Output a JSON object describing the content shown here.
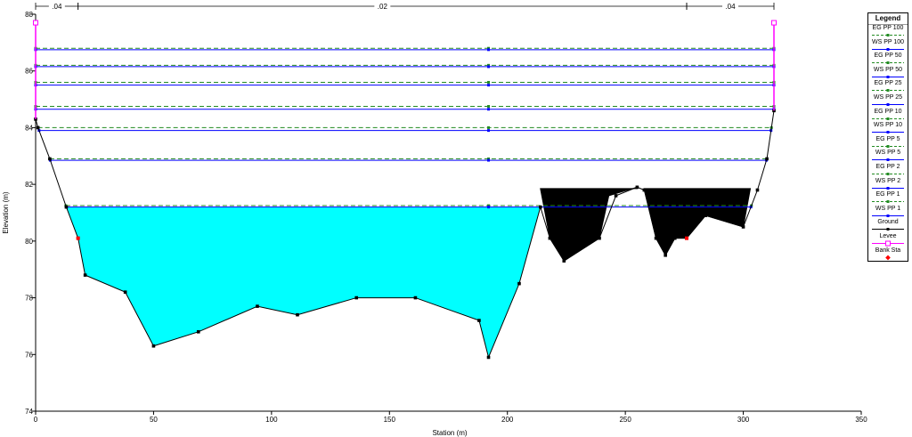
{
  "chart_data": {
    "type": "area",
    "xlabel": "Station (m)",
    "ylabel": "Elevation (m)",
    "xlim": [
      0,
      350
    ],
    "ylim": [
      74,
      88
    ],
    "x_ticks": [
      "0",
      "50",
      "100",
      "150",
      "200",
      "250",
      "300",
      "350"
    ],
    "y_ticks": [
      "74",
      "76",
      "78",
      "80",
      "82",
      "84",
      "86",
      "88"
    ],
    "manning_n": [
      {
        "label": ".04",
        "from": 0,
        "to": 18
      },
      {
        "label": ".02",
        "from": 18,
        "to": 276
      },
      {
        "label": ".04",
        "from": 276,
        "to": 313
      }
    ],
    "ground": {
      "name": "Ground",
      "color": "#000000",
      "x": [
        0,
        1,
        6,
        13,
        18,
        21,
        38,
        50,
        69,
        94,
        111,
        136,
        161,
        188,
        192,
        205,
        214,
        218,
        224,
        239,
        246,
        255,
        258,
        263,
        267,
        271,
        276,
        284,
        300,
        306,
        310,
        313
      ],
      "y": [
        84.3,
        84.0,
        82.9,
        81.2,
        80.1,
        78.8,
        78.2,
        76.3,
        76.8,
        77.7,
        77.4,
        78.0,
        78.0,
        77.2,
        75.9,
        78.5,
        81.2,
        80.1,
        79.3,
        80.1,
        81.6,
        81.9,
        81.8,
        80.1,
        79.5,
        80.1,
        80.1,
        80.9,
        80.5,
        81.8,
        82.9,
        84.6
      ]
    },
    "ineffective_blocks": [
      {
        "x": [
          214,
          230,
          243,
          255,
          255,
          243,
          239,
          224,
          218
        ],
        "y": [
          81.85,
          81.85,
          81.85,
          81.85,
          81.9,
          81.6,
          80.1,
          79.3,
          80.1
        ]
      },
      {
        "x": [
          258,
          275,
          295,
          303,
          300,
          284,
          276,
          271,
          267,
          263
        ],
        "y": [
          81.85,
          81.85,
          81.85,
          81.85,
          80.5,
          80.9,
          80.1,
          80.1,
          79.5,
          80.1
        ]
      }
    ],
    "levee": {
      "name": "Levee",
      "color": "#ff00ff",
      "x": [
        0,
        313
      ],
      "y": [
        87.7,
        87.7
      ]
    },
    "bank_sta": {
      "name": "Bank Sta",
      "color": "#ff0000",
      "points": [
        {
          "x": 18,
          "y": 80.1
        },
        {
          "x": 276,
          "y": 80.1
        }
      ]
    },
    "water_fill": {
      "color": "#00ffff",
      "elevation": 81.2
    },
    "profiles": [
      {
        "name": "EG PP 100",
        "kind": "EG",
        "y": 86.8,
        "color": "#228b22"
      },
      {
        "name": "WS PP 100",
        "kind": "WS",
        "y": 86.75,
        "color": "#0000ff"
      },
      {
        "name": "EG PP 50",
        "kind": "EG",
        "y": 86.2,
        "color": "#228b22"
      },
      {
        "name": "WS PP 50",
        "kind": "WS",
        "y": 86.15,
        "color": "#0000ff"
      },
      {
        "name": "EG PP 25",
        "kind": "EG",
        "y": 85.6,
        "color": "#228b22"
      },
      {
        "name": "WS PP 25",
        "kind": "WS",
        "y": 85.5,
        "color": "#0000ff"
      },
      {
        "name": "EG PP 10",
        "kind": "EG",
        "y": 84.75,
        "color": "#228b22"
      },
      {
        "name": "WS PP 10",
        "kind": "WS",
        "y": 84.65,
        "color": "#0000ff"
      },
      {
        "name": "EG PP 5",
        "kind": "EG",
        "y": 84.0,
        "color": "#228b22"
      },
      {
        "name": "WS PP 5",
        "kind": "WS",
        "y": 83.9,
        "color": "#0000ff"
      },
      {
        "name": "EG PP 2",
        "kind": "EG",
        "y": 82.9,
        "color": "#228b22"
      },
      {
        "name": "WS PP 2",
        "kind": "WS",
        "y": 82.85,
        "color": "#0000ff"
      },
      {
        "name": "EG PP 1",
        "kind": "EG",
        "y": 81.25,
        "color": "#228b22"
      },
      {
        "name": "WS PP 1",
        "kind": "WS",
        "y": 81.2,
        "color": "#0000ff"
      }
    ],
    "legend": {
      "title": "Legend",
      "placement": "right",
      "entries": [
        {
          "label": "EG PP 100",
          "color": "#228b22",
          "style": "dashed"
        },
        {
          "label": "WS PP 100",
          "color": "#0000ff",
          "style": "solid"
        },
        {
          "label": "EG PP 50",
          "color": "#228b22",
          "style": "dashed"
        },
        {
          "label": "WS PP 50",
          "color": "#0000ff",
          "style": "solid"
        },
        {
          "label": "EG PP 25",
          "color": "#228b22",
          "style": "dashed"
        },
        {
          "label": "WS PP 25",
          "color": "#0000ff",
          "style": "solid"
        },
        {
          "label": "EG PP 10",
          "color": "#228b22",
          "style": "dashed"
        },
        {
          "label": "WS PP 10",
          "color": "#0000ff",
          "style": "solid"
        },
        {
          "label": "EG PP 5",
          "color": "#228b22",
          "style": "dashed"
        },
        {
          "label": "WS PP 5",
          "color": "#0000ff",
          "style": "solid"
        },
        {
          "label": "EG PP 2",
          "color": "#228b22",
          "style": "dashed"
        },
        {
          "label": "WS PP 2",
          "color": "#0000ff",
          "style": "solid"
        },
        {
          "label": "EG PP 1",
          "color": "#228b22",
          "style": "dashed"
        },
        {
          "label": "WS PP 1",
          "color": "#0000ff",
          "style": "solid"
        },
        {
          "label": "Ground",
          "color": "#000000",
          "style": "solid"
        },
        {
          "label": "Levee",
          "color": "#ff00ff",
          "style": "levee"
        },
        {
          "label": "Bank Sta",
          "color": "#ff0000",
          "style": "marker"
        }
      ]
    }
  }
}
